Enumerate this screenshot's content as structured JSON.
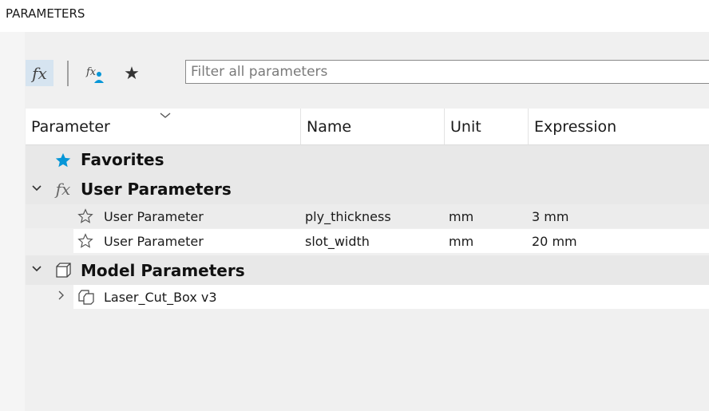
{
  "panel": {
    "title": "PARAMETERS"
  },
  "toolbar": {
    "fx_label": "fx",
    "user_fx_label": "fx",
    "favorites_star": "★",
    "filter_placeholder": "Filter all parameters",
    "filter_value": ""
  },
  "columns": [
    "Parameter",
    "Name",
    "Unit",
    "Expression"
  ],
  "groups": {
    "favorites": {
      "label": "Favorites"
    },
    "user_parameters": {
      "label": "User Parameters",
      "rows": [
        {
          "parameter": "User Parameter",
          "name": "ply_thickness",
          "unit": "mm",
          "expression": "3 mm"
        },
        {
          "parameter": "User Parameter",
          "name": "slot_width",
          "unit": "mm",
          "expression": "20 mm"
        }
      ]
    },
    "model_parameters": {
      "label": "Model Parameters",
      "rows": [
        {
          "parameter": "Laser_Cut_Box v3"
        }
      ]
    }
  },
  "colors": {
    "accent": "#0696d7",
    "selected_btn": "#d6e4f0"
  }
}
